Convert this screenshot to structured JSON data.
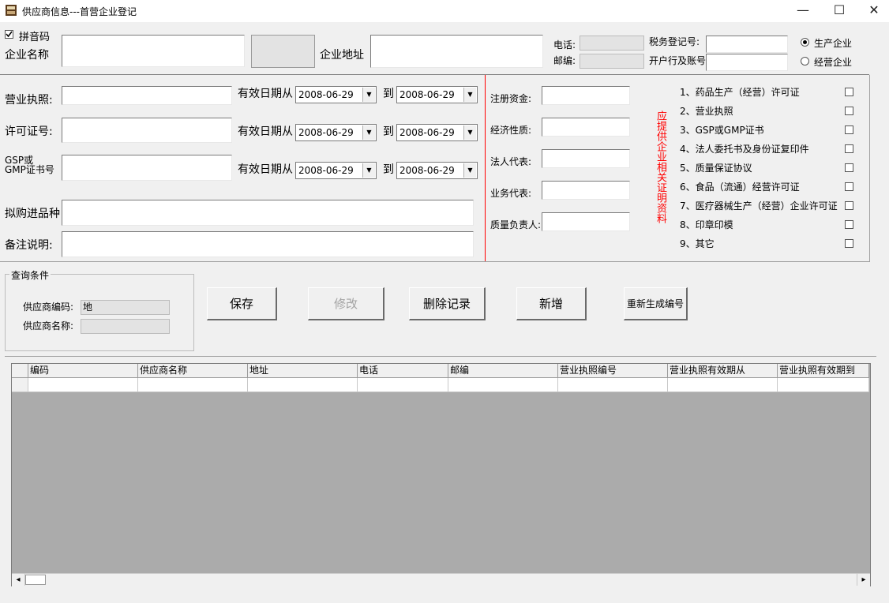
{
  "window": {
    "title": "供应商信息---首营企业登记",
    "minimize_glyph": "—",
    "maximize_glyph": "☐",
    "close_glyph": "✕"
  },
  "top": {
    "pinyin_label": "拼音码",
    "pinyin_checked": true,
    "company_name_label": "企业名称",
    "company_address_label": "企业地址",
    "phone_label": "电话:",
    "postcode_label": "邮编:",
    "tax_reg_label": "税务登记号:",
    "bank_account_label": "开户行及账号",
    "radio_production": "生产企业",
    "radio_trading": "经营企业",
    "selected_type": "生产企业"
  },
  "licenses": {
    "business_license_label": "营业执照:",
    "permit_label": "许可证号:",
    "gsp_label_line1": "GSP或",
    "gsp_label_line2": "GMP证书号",
    "valid_from_label": "有效日期从",
    "to_label": "到",
    "dates": {
      "bl_from": "2008-06-29",
      "bl_to": "2008-06-29",
      "permit_from": "2008-06-29",
      "permit_to": "2008-06-29",
      "gsp_from": "2008-06-29",
      "gsp_to": "2008-06-29"
    },
    "purchase_variety_label": "拟购进品种",
    "remarks_label": "备注说明:"
  },
  "middle": {
    "reg_capital_label": "注册资金:",
    "econ_nature_label": "经济性质:",
    "legal_rep_label": "法人代表:",
    "business_rep_label": "业务代表:",
    "quality_head_label": "质量负责人:",
    "vertical_note": "应提供企业相关证明资料"
  },
  "documents": [
    {
      "label": "1、药品生产（经营）许可证",
      "checked": false
    },
    {
      "label": "2、营业执照",
      "checked": false
    },
    {
      "label": "3、GSP或GMP证书",
      "checked": false
    },
    {
      "label": "4、法人委托书及身份证复印件",
      "checked": false
    },
    {
      "label": "5、质量保证协议",
      "checked": false
    },
    {
      "label": "6、食品（流通）经营许可证",
      "checked": false
    },
    {
      "label": "7、医疗器械生产（经营）企业许可证",
      "checked": false
    },
    {
      "label": "8、印章印模",
      "checked": false
    },
    {
      "label": "9、其它",
      "checked": false
    }
  ],
  "query": {
    "group_title": "查询条件",
    "supplier_code_label": "供应商编码:",
    "supplier_code_value": "地",
    "supplier_name_label": "供应商名称:",
    "supplier_name_value": ""
  },
  "buttons": {
    "save": "保存",
    "edit": "修改",
    "delete": "删除记录",
    "add": "新增",
    "regenerate": "重新生成编号"
  },
  "grid": {
    "columns": [
      "编码",
      "供应商名称",
      "地址",
      "电话",
      "邮编",
      "营业执照编号",
      "营业执照有效期从",
      "营业执照有效期到"
    ],
    "scroll_left": "◂",
    "scroll_right": "▸"
  }
}
